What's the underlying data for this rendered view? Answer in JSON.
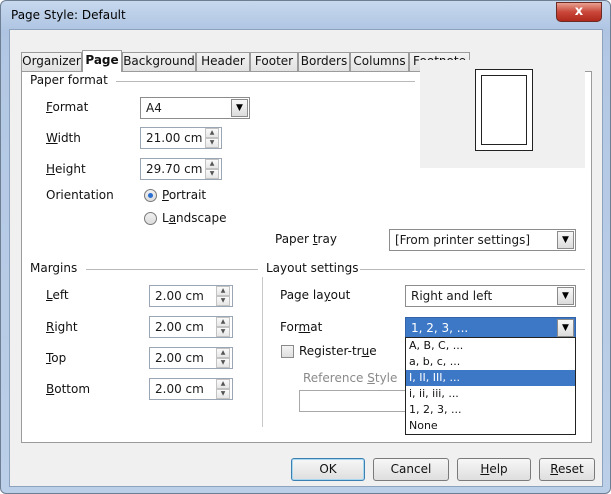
{
  "window": {
    "title": "Page Style: Default",
    "close_glyph": "x"
  },
  "tabs": [
    "Organizer",
    "Page",
    "Background",
    "Header",
    "Footer",
    "Borders",
    "Columns",
    "Footnote"
  ],
  "paper_format": {
    "section_label": "Paper format",
    "format_label": "Format",
    "format_value": "A4",
    "width_label": "Width",
    "width_value": "21.00 cm",
    "height_label": "Height",
    "height_value": "29.70 cm",
    "orientation_label": "Orientation",
    "portrait_label": "Portrait",
    "landscape_label": "Landscape",
    "orientation_selected": "Portrait"
  },
  "paper_tray": {
    "label": "Paper tray",
    "value": "[From printer settings]"
  },
  "margins": {
    "section_label": "Margins",
    "left_label": "Left",
    "left_value": "2.00 cm",
    "right_label": "Right",
    "right_value": "2.00 cm",
    "top_label": "Top",
    "top_value": "2.00 cm",
    "bottom_label": "Bottom",
    "bottom_value": "2.00 cm"
  },
  "layout": {
    "section_label": "Layout settings",
    "page_layout_label": "Page layout",
    "page_layout_value": "Right and left",
    "format_label": "Format",
    "format_value": "1, 2, 3, ...",
    "register_true_label": "Register-true",
    "reference_style_label": "Reference Style",
    "format_options": [
      "A, B, C, ...",
      "a, b, c, ...",
      "I, II, III, ...",
      "i, ii, iii, ...",
      "1, 2, 3, ...",
      "None"
    ],
    "format_highlighted": "I, II, III, ..."
  },
  "buttons": {
    "ok": "OK",
    "cancel": "Cancel",
    "help": "Help",
    "reset": "Reset"
  },
  "colors": {
    "highlight": "#3d78c7",
    "close_button": "#c9473a",
    "title_bar": "#b3c8e4"
  }
}
